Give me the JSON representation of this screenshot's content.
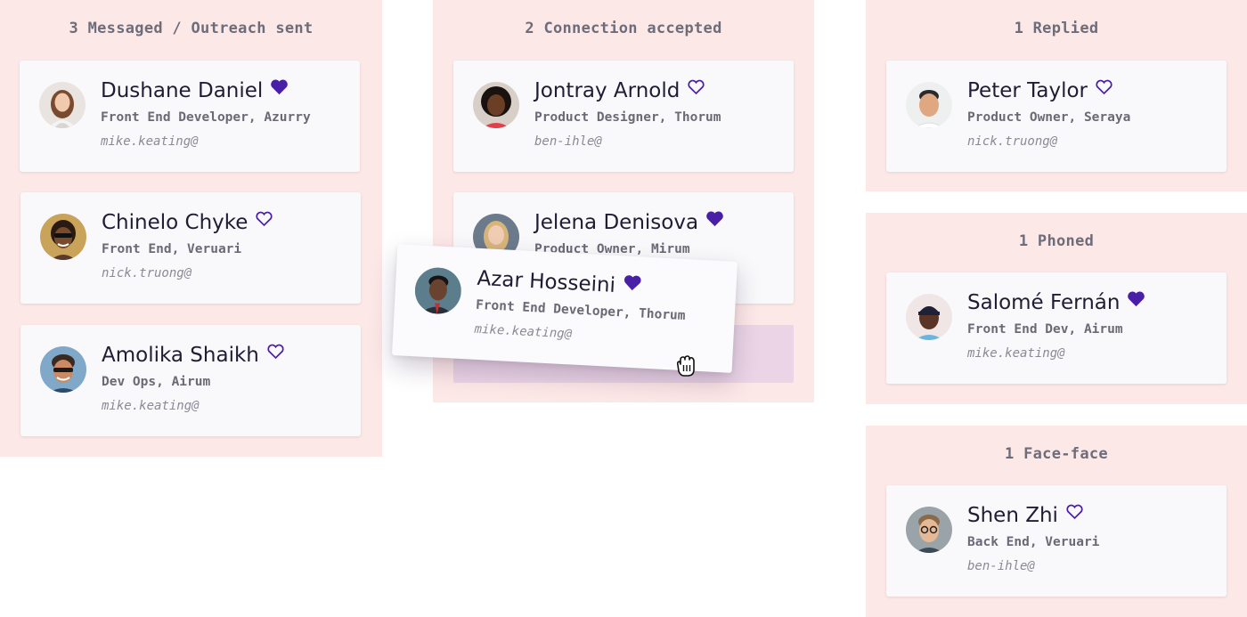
{
  "accent_color": "#4a1fa8",
  "columns": [
    {
      "title": "3 Messaged / Outreach sent",
      "cards": [
        {
          "name": "Dushane Daniel",
          "role": "Front End Developer, Azurry",
          "email": "mike.keating@",
          "favorited": true,
          "avatar_icon": "woman-avatar-icon"
        },
        {
          "name": "Chinelo Chyke",
          "role": "Front End, Veruari",
          "email": "nick.truong@",
          "favorited": false,
          "avatar_icon": "woman-sunglasses-avatar-icon"
        },
        {
          "name": "Amolika Shaikh",
          "role": "Dev Ops, Airum",
          "email": "mike.keating@",
          "favorited": false,
          "avatar_icon": "man-sunglasses-avatar-icon"
        }
      ]
    },
    {
      "title": "2 Connection accepted",
      "cards": [
        {
          "name": "Jontray Arnold",
          "role": "Product Designer, Thorum",
          "email": "ben-ihle@",
          "favorited": false,
          "avatar_icon": "woman-curly-hair-avatar-icon"
        },
        {
          "name": "Jelena Denisova",
          "role": "Product Owner, Mirum",
          "email": "",
          "favorited": true,
          "avatar_icon": "woman-blonde-avatar-icon"
        }
      ]
    },
    {
      "title": "1 Replied",
      "cards": [
        {
          "name": "Peter Taylor",
          "role": "Product Owner, Seraya",
          "email": "nick.truong@",
          "favorited": false,
          "avatar_icon": "man-avatar-icon"
        }
      ]
    },
    {
      "title": "1 Phoned",
      "cards": [
        {
          "name": "Salomé Fernán",
          "role": "Front End Dev, Airum",
          "email": "mike.keating@",
          "favorited": true,
          "avatar_icon": "man-cap-avatar-icon"
        }
      ]
    },
    {
      "title": "1 Face-face",
      "cards": [
        {
          "name": "Shen Zhi",
          "role": "Back End, Veruari",
          "email": "ben-ihle@",
          "favorited": false,
          "avatar_icon": "man-glasses-avatar-icon"
        }
      ]
    }
  ],
  "dragging_card": {
    "name": "Azar Hosseini",
    "role": "Front End Developer, Thorum",
    "email": "mike.keating@",
    "favorited": true,
    "avatar_icon": "man-suit-avatar-icon"
  },
  "cursor_icon": "grab-hand-cursor-icon"
}
